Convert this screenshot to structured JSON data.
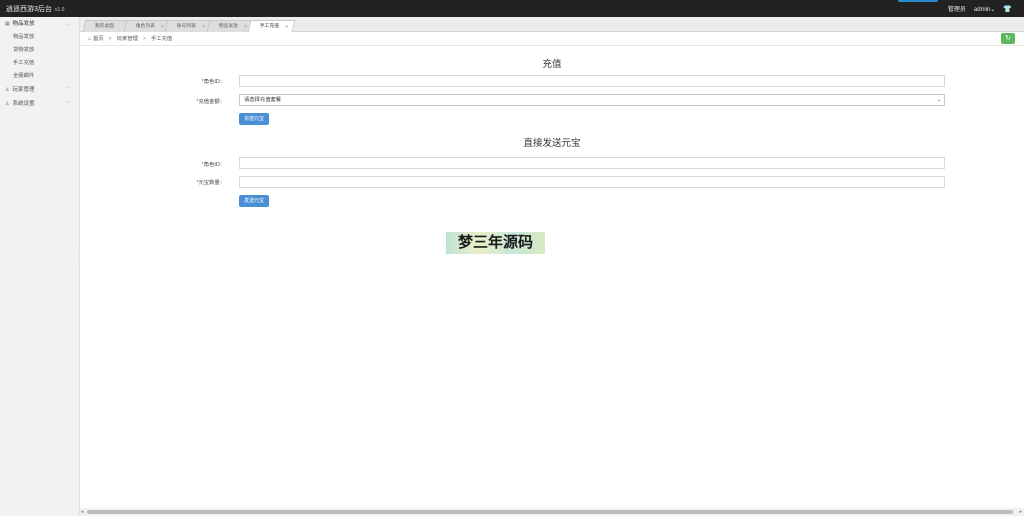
{
  "topbar": {
    "brand": "逍遥西游3后台",
    "version": "v1.0",
    "role": "管理员",
    "user": "admin",
    "user_caret": "⌄",
    "shirt_icon": "tshirt-icon",
    "accent": "#2a8bd0"
  },
  "sidebar": {
    "groups": [
      {
        "label": "物品发放",
        "icon": "grid-icon",
        "open": true,
        "items": [
          "物品发放",
          "货物发放",
          "手工充值",
          "全服邮件"
        ]
      },
      {
        "label": "玩家管理",
        "icon": "user-icon",
        "open": false,
        "items": []
      },
      {
        "label": "系统设置",
        "icon": "user-settings-icon",
        "open": false,
        "items": []
      }
    ]
  },
  "tabs": [
    {
      "label": "我的桌面",
      "closable": false,
      "active": false
    },
    {
      "label": "角色列表",
      "closable": true,
      "active": false
    },
    {
      "label": "账号列表",
      "closable": true,
      "active": false
    },
    {
      "label": "物品发放",
      "closable": true,
      "active": false
    },
    {
      "label": "手工充值",
      "closable": true,
      "active": true
    }
  ],
  "breadcrumb": {
    "home": "首页",
    "level1": "玩家管理",
    "level2": "手工充值",
    "arrow": ">"
  },
  "recharge": {
    "title": "充值",
    "role_id_label": "角色ID：",
    "amount_label": "充值金额：",
    "amount_selected": "请选择充值套餐",
    "submit_label": "充值元宝"
  },
  "direct": {
    "title": "直接发送元宝",
    "role_id_label": "角色ID：",
    "qty_label": "元宝数量：",
    "submit_label": "发送元宝"
  },
  "required_mark": "*",
  "watermark": "梦三年源码",
  "colors": {
    "topbar": "#222222",
    "primary_button": "#4a8fd4",
    "refresh_button": "#5cb85c"
  }
}
